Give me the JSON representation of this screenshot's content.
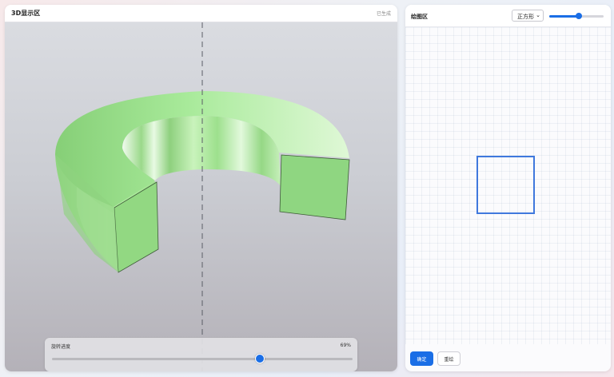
{
  "viewer": {
    "title": "3D显示区",
    "status": "已生成",
    "rotation": {
      "label": "旋转进度",
      "value_text": "69%",
      "value": 0.69
    },
    "model_color": "#8fd67f"
  },
  "drawing": {
    "title": "绘图区",
    "shape_select": {
      "selected": "正方形"
    },
    "size_slider": {
      "value": 0.55
    },
    "shape_color": "#3f78dd",
    "buttons": {
      "confirm_label": "确定",
      "reset_label": "重绘"
    }
  },
  "colors": {
    "accent": "#1a6ee6"
  }
}
